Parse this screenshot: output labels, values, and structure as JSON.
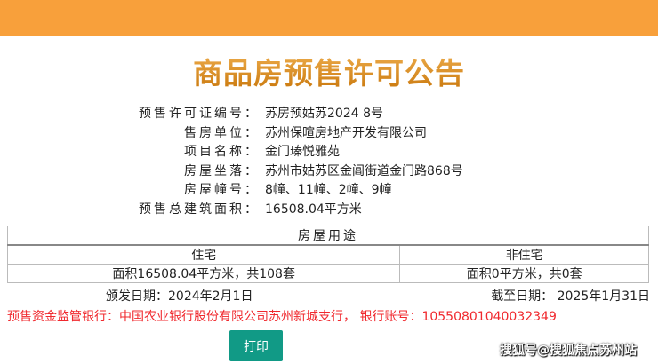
{
  "title": "商品房预售许可公告",
  "info": [
    {
      "label": "预售许可证编号：",
      "value": "苏房预姑苏2024 8号"
    },
    {
      "label": "售房单位：",
      "value": "苏州保暄房地产开发有限公司"
    },
    {
      "label": "项目名称：",
      "value": "金门瑧悦雅苑"
    },
    {
      "label": "房屋坐落：",
      "value": "苏州市姑苏区金阊街道金门路868号"
    },
    {
      "label": "房屋幢号：",
      "value": "8幢、11幢、2幢、9幢"
    },
    {
      "label": "预售总建筑面积：",
      "value": "16508.04平方米"
    }
  ],
  "table": {
    "header": "房屋用途",
    "col1": "住宅",
    "col2": "非住宅",
    "val1": "面积16508.04平方米，共108套",
    "val2": "面积0平方米，共0套"
  },
  "issue_date": "颁发日期：2024年2月1日",
  "end_date": "截至日期： 2025年1月31日",
  "bank": "预售资金监管银行：中国农业银行股份有限公司苏州新城支行， 银行账号：10550801040032349",
  "print_label": "打印",
  "watermark": "搜狐号@搜狐焦点苏州站"
}
